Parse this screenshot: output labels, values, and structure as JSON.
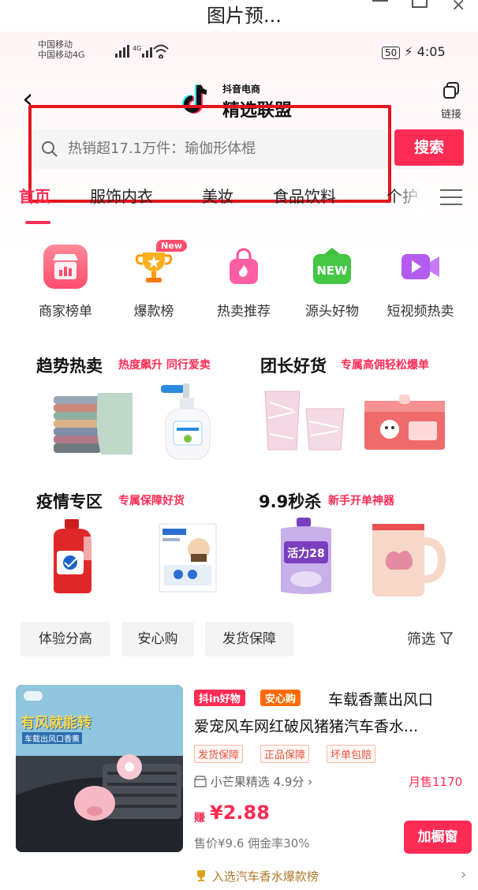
{
  "window": {
    "title": "图片预..."
  },
  "status_bar": {
    "carrier_1": "中国移动",
    "carrier_2": "中国移动4G",
    "signal": "4G",
    "battery": "50",
    "time": "4:05"
  },
  "header": {
    "logo_sub": "抖音电商",
    "logo_main": "精选联盟",
    "link_label": "链接"
  },
  "search": {
    "placeholder": "热销超17.1万件：瑜伽形体棍",
    "button_label": "搜索"
  },
  "tabs": [
    {
      "label": "首页",
      "active": true
    },
    {
      "label": "服饰内衣",
      "active": false
    },
    {
      "label": "美妆",
      "active": false
    },
    {
      "label": "食品饮料",
      "active": false
    },
    {
      "label": "个护",
      "active": false
    }
  ],
  "categories": [
    {
      "label": "商家榜单",
      "icon": "shop-chart-icon",
      "color": "#ff5a72"
    },
    {
      "label": "爆款榜",
      "icon": "trophy-icon",
      "color": "#ffb020",
      "badge": "New"
    },
    {
      "label": "热卖推荐",
      "icon": "fire-bag-icon",
      "color": "#ff4f95"
    },
    {
      "label": "源头好物",
      "icon": "new-tag-icon",
      "color": "#3fbf3f"
    },
    {
      "label": "短视频热卖",
      "icon": "video-icon",
      "color": "#b45cf0"
    }
  ],
  "sections": {
    "trend": {
      "title": "趋势热卖",
      "subtitle": "热度飙升 同行爱卖"
    },
    "leader": {
      "title": "团长好货",
      "subtitle": "专属高佣轻松爆单"
    },
    "epidemic": {
      "title": "疫情专区",
      "subtitle": "专属保障好货"
    },
    "flash": {
      "title": "9.9秒杀",
      "subtitle": "新手开单神器"
    }
  },
  "filters": {
    "items": [
      "体验分高",
      "安心购",
      "发货保障"
    ],
    "screen_label": "筛选"
  },
  "product": {
    "image_caption": "有风就能转",
    "image_caption_small": "车载出风口香薰",
    "tag_1": "抖in好物",
    "tag_2": "安心购",
    "title_line_1": "车载香薰出风口",
    "title_line_2": "爱宠风车网红破风猪猪汽车香水...",
    "services": [
      "发货保障",
      "正品保障",
      "坏单包赔"
    ],
    "shop": "小芒果精选 4.9分 ›",
    "sales": "月售1170",
    "earn_label": "赚",
    "earn_value": "¥2.88",
    "price_info": "售价¥9.6  佣金率30%",
    "add_button": "加橱窗",
    "rank_link": "入选汽车香水爆款榜"
  },
  "colors": {
    "accent": "#fe2c55",
    "highlight_frame": "#e4141e"
  }
}
